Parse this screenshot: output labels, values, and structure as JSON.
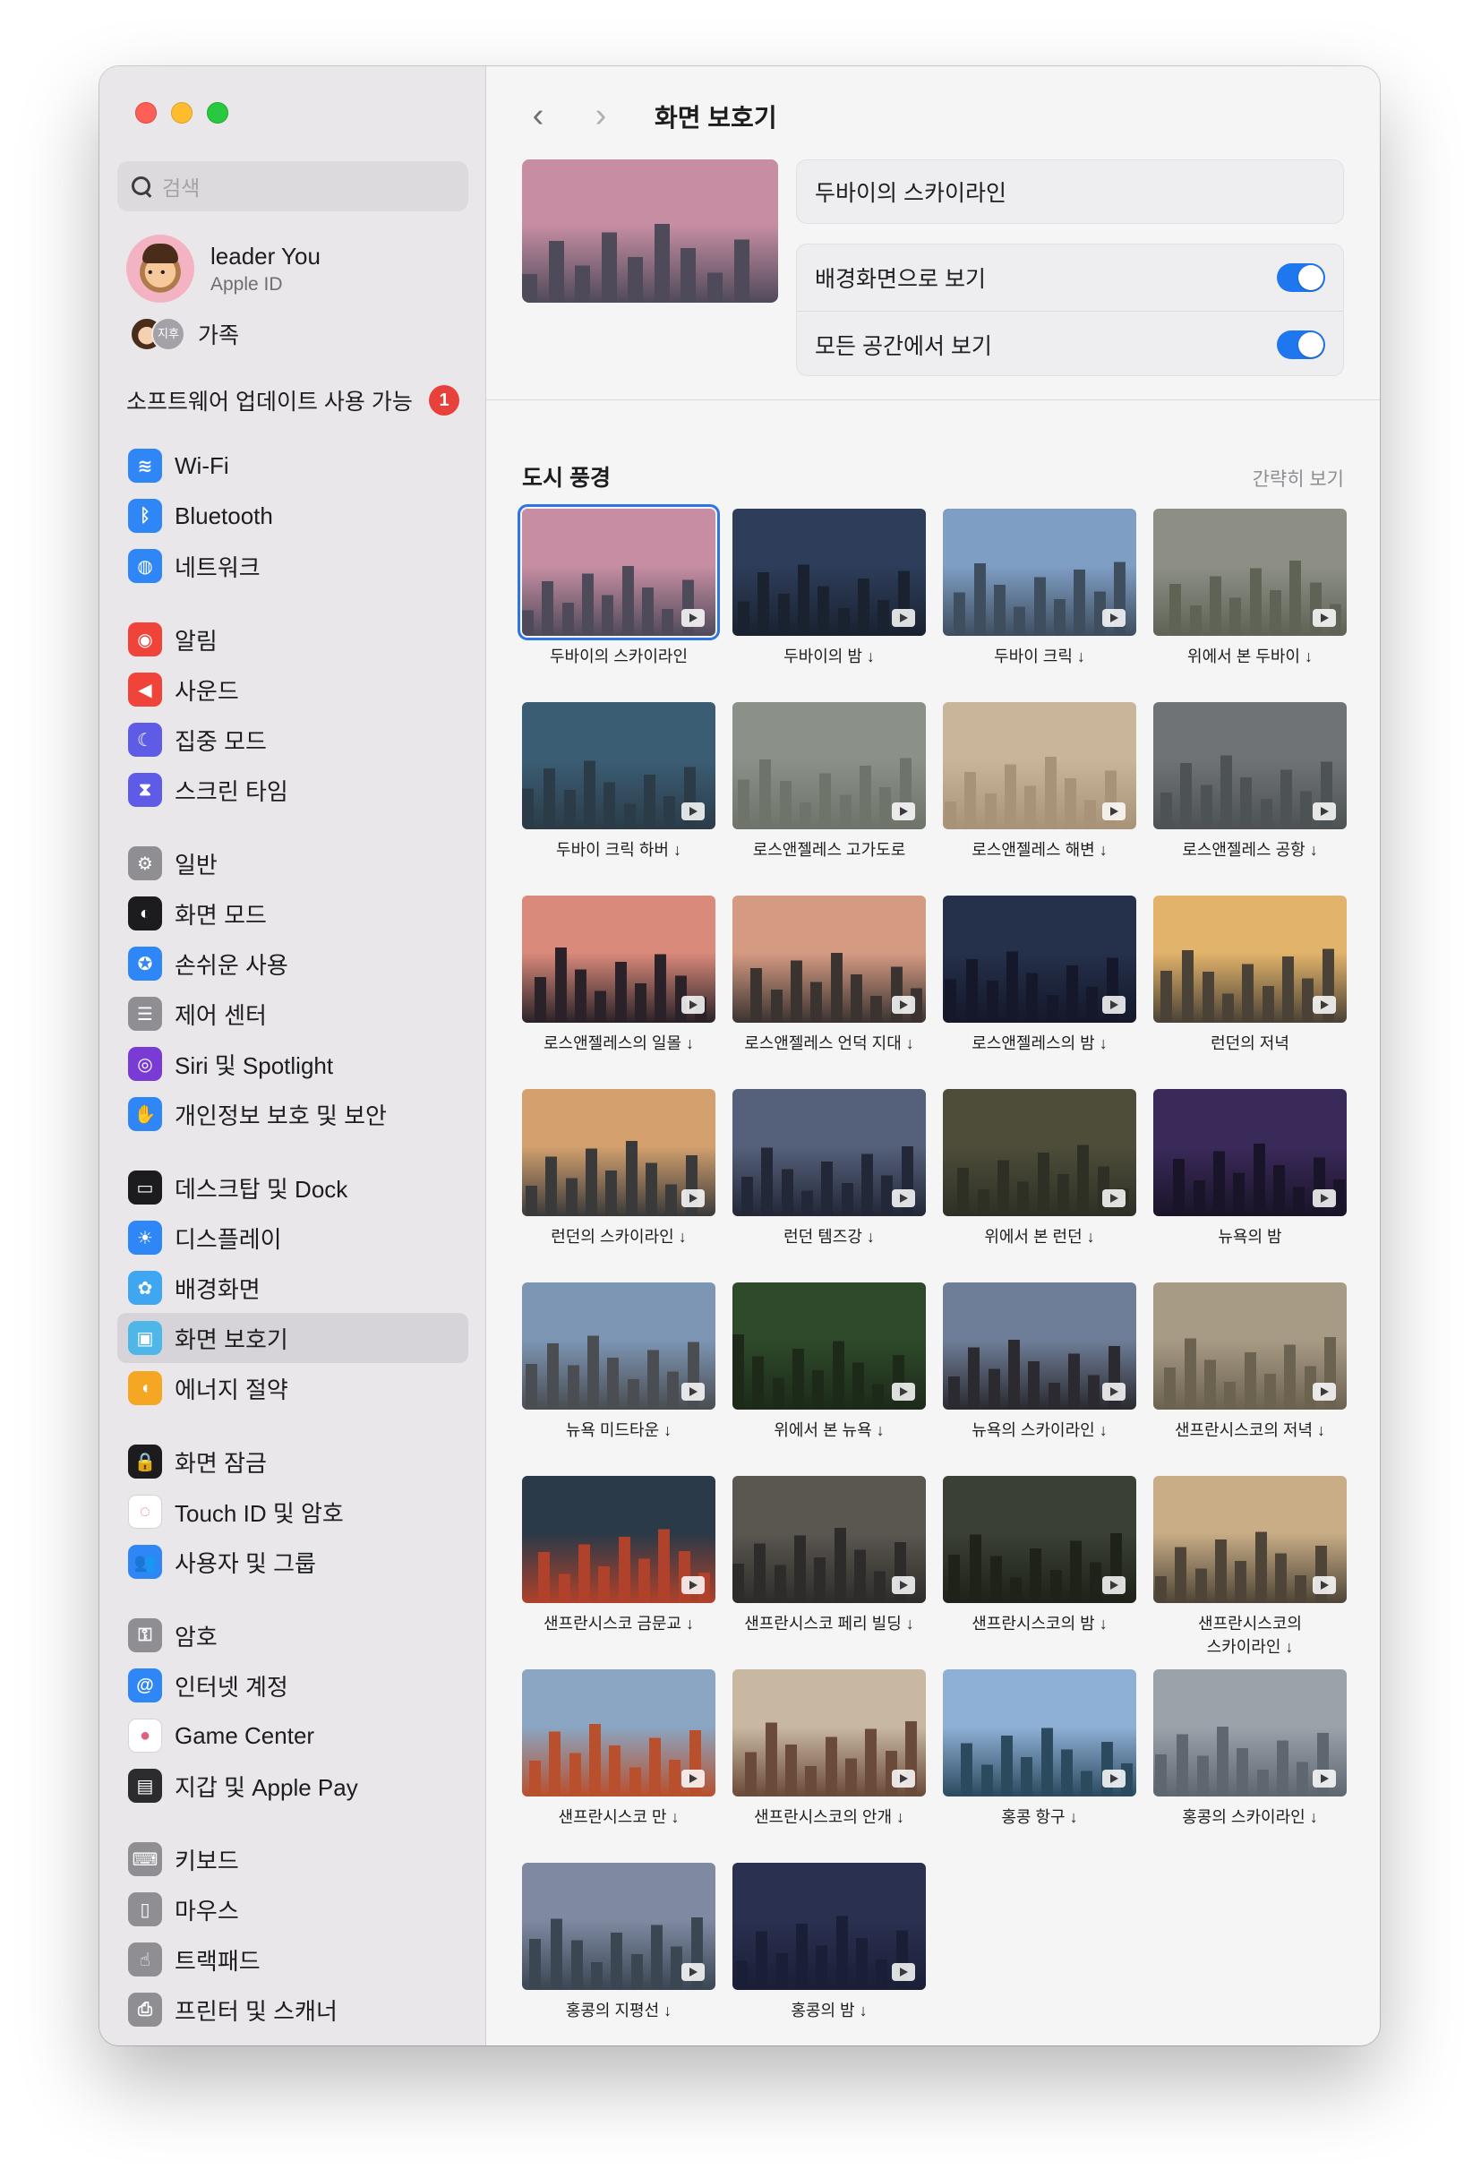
{
  "window": {
    "title": "화면 보호기"
  },
  "sidebar": {
    "search_placeholder": "검색",
    "account": {
      "name": "leader You",
      "subtitle": "Apple ID"
    },
    "family": {
      "label": "가족",
      "second_avatar": "지후"
    },
    "software_update": {
      "label": "소프트웨어 업데이트 사용 가능",
      "badge": "1"
    },
    "groups": [
      [
        {
          "label": "Wi-Fi",
          "icon": "wifi-icon",
          "color": "#2f86f6",
          "glyph": "≋"
        },
        {
          "label": "Bluetooth",
          "icon": "bluetooth-icon",
          "color": "#2f86f6",
          "glyph": "ᛒ"
        },
        {
          "label": "네트워크",
          "icon": "globe-icon",
          "color": "#2f86f6",
          "glyph": "◍"
        }
      ],
      [
        {
          "label": "알림",
          "icon": "bell-icon",
          "color": "#f0443a",
          "glyph": "◉"
        },
        {
          "label": "사운드",
          "icon": "speaker-icon",
          "color": "#f0443a",
          "glyph": "◀"
        },
        {
          "label": "집중 모드",
          "icon": "moon-icon",
          "color": "#5e5ce6",
          "glyph": "☾"
        },
        {
          "label": "스크린 타임",
          "icon": "hourglass-icon",
          "color": "#5e5ce6",
          "glyph": "⧗"
        }
      ],
      [
        {
          "label": "일반",
          "icon": "gear-icon",
          "color": "#8e8e93",
          "glyph": "⚙"
        },
        {
          "label": "화면 모드",
          "icon": "appearance-icon",
          "color": "#1c1c1e",
          "glyph": "◐"
        },
        {
          "label": "손쉬운 사용",
          "icon": "accessibility-icon",
          "color": "#2f86f6",
          "glyph": "✪"
        },
        {
          "label": "제어 센터",
          "icon": "control-center-icon",
          "color": "#8e8e93",
          "glyph": "☰"
        },
        {
          "label": "Siri 및 Spotlight",
          "icon": "siri-icon",
          "color": "#7a3bd4",
          "glyph": "◎"
        },
        {
          "label": "개인정보 보호 및 보안",
          "icon": "hand-icon",
          "color": "#2f86f6",
          "glyph": "✋"
        }
      ],
      [
        {
          "label": "데스크탑 및 Dock",
          "icon": "dock-icon",
          "color": "#1c1c1e",
          "glyph": "▭"
        },
        {
          "label": "디스플레이",
          "icon": "sun-icon",
          "color": "#2f86f6",
          "glyph": "☀"
        },
        {
          "label": "배경화면",
          "icon": "flower-icon",
          "color": "#3fa6f2",
          "glyph": "✿"
        },
        {
          "label": "화면 보호기",
          "icon": "screensaver-icon",
          "color": "#4fb6e8",
          "glyph": "▣"
        },
        {
          "label": "에너지 절약",
          "icon": "bulb-icon",
          "color": "#f5a623",
          "glyph": "◖"
        }
      ],
      [
        {
          "label": "화면 잠금",
          "icon": "lock-icon",
          "color": "#1c1c1e",
          "glyph": "🔒"
        },
        {
          "label": "Touch ID 및 암호",
          "icon": "fingerprint-icon",
          "color": "#ffffff",
          "glyph": "◌"
        },
        {
          "label": "사용자 및 그룹",
          "icon": "users-icon",
          "color": "#2f86f6",
          "glyph": "👥"
        }
      ],
      [
        {
          "label": "암호",
          "icon": "key-icon",
          "color": "#8e8e93",
          "glyph": "⚿"
        },
        {
          "label": "인터넷 계정",
          "icon": "at-icon",
          "color": "#2f86f6",
          "glyph": "@"
        },
        {
          "label": "Game Center",
          "icon": "game-center-icon",
          "color": "#ffffff",
          "glyph": "●"
        },
        {
          "label": "지갑 및 Apple Pay",
          "icon": "wallet-icon",
          "color": "#2c2c2e",
          "glyph": "▤"
        }
      ],
      [
        {
          "label": "키보드",
          "icon": "keyboard-icon",
          "color": "#8e8e93",
          "glyph": "⌨"
        },
        {
          "label": "마우스",
          "icon": "mouse-icon",
          "color": "#8e8e93",
          "glyph": "▯"
        },
        {
          "label": "트랙패드",
          "icon": "trackpad-icon",
          "color": "#8e8e93",
          "glyph": "☝"
        },
        {
          "label": "프린터 및 스캐너",
          "icon": "printer-icon",
          "color": "#8e8e93",
          "glyph": "⎙"
        }
      ]
    ],
    "selected": "화면 보호기"
  },
  "main": {
    "title": "화면 보호기",
    "current_name": "두바이의 스카이라인",
    "toggles": [
      {
        "label": "배경화면으로 보기",
        "on": true
      },
      {
        "label": "모든 공간에서 보기",
        "on": true
      }
    ],
    "section_title": "도시 풍경",
    "section_link": "간략히 보기",
    "accent": "#1f77ef",
    "items": [
      {
        "label": "두바이의 스카이라인",
        "selected": true,
        "sky": "#c78ea3",
        "ground": "#4f4a5a"
      },
      {
        "label": "두바이의 밤 ↓",
        "sky": "#2d3d5a",
        "ground": "#1a2230"
      },
      {
        "label": "두바이 크릭 ↓",
        "sky": "#7f9ec4",
        "ground": "#3e4e5e"
      },
      {
        "label": "위에서 본 두바이 ↓",
        "sky": "#8d8f86",
        "ground": "#5e6356"
      },
      {
        "label": "두바이 크릭 하버 ↓",
        "sky": "#3b5d74",
        "ground": "#2b3c48"
      },
      {
        "label": "로스앤젤레스 고가도로",
        "sky": "#8b9088",
        "ground": "#6e746a"
      },
      {
        "label": "로스앤젤레스 해변 ↓",
        "sky": "#c8b59a",
        "ground": "#a89378"
      },
      {
        "label": "로스앤젤레스 공항 ↓",
        "sky": "#6f7375",
        "ground": "#4d5255"
      },
      {
        "label": "로스앤젤레스의 일몰 ↓",
        "sky": "#d98a7a",
        "ground": "#2a2228"
      },
      {
        "label": "로스앤젤레스 언덕 지대 ↓",
        "sky": "#d59a82",
        "ground": "#3a3330"
      },
      {
        "label": "로스앤젤레스의 밤 ↓",
        "sky": "#25304a",
        "ground": "#14182a"
      },
      {
        "label": "런던의 저녁",
        "sky": "#e2b36a",
        "ground": "#4a4236"
      },
      {
        "label": "런던의 스카이라인 ↓",
        "sky": "#d3a06e",
        "ground": "#3a3a3a"
      },
      {
        "label": "런던 템즈강 ↓",
        "sky": "#55607a",
        "ground": "#232838"
      },
      {
        "label": "위에서 본 런던 ↓",
        "sky": "#4e4d3a",
        "ground": "#2e3026"
      },
      {
        "label": "뉴욕의 밤",
        "sky": "#3a2a5a",
        "ground": "#1a1428"
      },
      {
        "label": "뉴욕 미드타운 ↓",
        "sky": "#7d96b4",
        "ground": "#4a4d52"
      },
      {
        "label": "위에서 본 뉴욕 ↓",
        "sky": "#2e4a2a",
        "ground": "#1d2a1a"
      },
      {
        "label": "뉴욕의 스카이라인 ↓",
        "sky": "#6f7e98",
        "ground": "#2a2a30"
      },
      {
        "label": "샌프란시스코의 저녁 ↓",
        "sky": "#a89b86",
        "ground": "#6b6250"
      },
      {
        "label": "샌프란시스코 금문교 ↓",
        "sky": "#2a3a48",
        "ground": "#b0412a"
      },
      {
        "label": "샌프란시스코 페리 빌딩 ↓",
        "sky": "#5a5650",
        "ground": "#2e2c2a"
      },
      {
        "label": "샌프란시스코의 밤 ↓",
        "sky": "#3a4034",
        "ground": "#1e2218"
      },
      {
        "label": "샌프란시스코의\n스카이라인 ↓",
        "sky": "#c8ad86",
        "ground": "#4e4538"
      },
      {
        "label": "샌프란시스코 만 ↓",
        "sky": "#8aa6c2",
        "ground": "#b8502e"
      },
      {
        "label": "샌프란시스코의 안개 ↓",
        "sky": "#c8b8a2",
        "ground": "#6a4a38"
      },
      {
        "label": "홍콩 항구 ↓",
        "sky": "#8fb0d6",
        "ground": "#2c4a5e"
      },
      {
        "label": "홍콩의 스카이라인 ↓",
        "sky": "#9aa2aa",
        "ground": "#5e6670"
      },
      {
        "label": "홍콩의 지평선 ↓",
        "sky": "#7f8aa2",
        "ground": "#3a4652"
      },
      {
        "label": "홍콩의 밤 ↓",
        "sky": "#2a3050",
        "ground": "#1a1e36"
      }
    ]
  }
}
